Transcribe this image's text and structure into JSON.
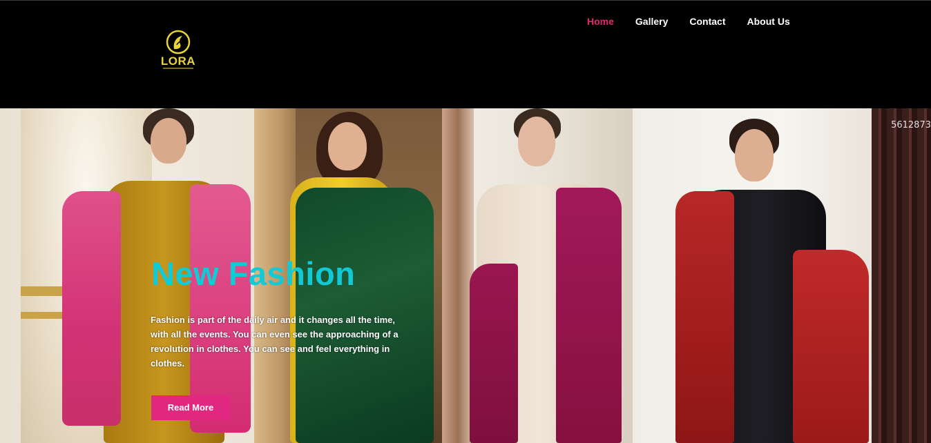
{
  "brand": {
    "name": "LORA"
  },
  "nav": {
    "items": [
      {
        "label": "Home",
        "active": true
      },
      {
        "label": "Gallery",
        "active": false
      },
      {
        "label": "Contact",
        "active": false
      },
      {
        "label": "About Us",
        "active": false
      }
    ]
  },
  "hero": {
    "title": "New Fashion",
    "description": "Fashion is part of the daily air and it changes all the time, with all the events. You can even see the approaching of a revolution in clothes. You can see and feel everything in clothes.",
    "button_label": "Read More",
    "image_code": "5612873"
  },
  "colors": {
    "accent": "#e5246e",
    "title": "#12c9d6",
    "button": "#e22780",
    "logo": "#e9d43a"
  },
  "icons": {
    "logo": "lora-logo-icon"
  }
}
